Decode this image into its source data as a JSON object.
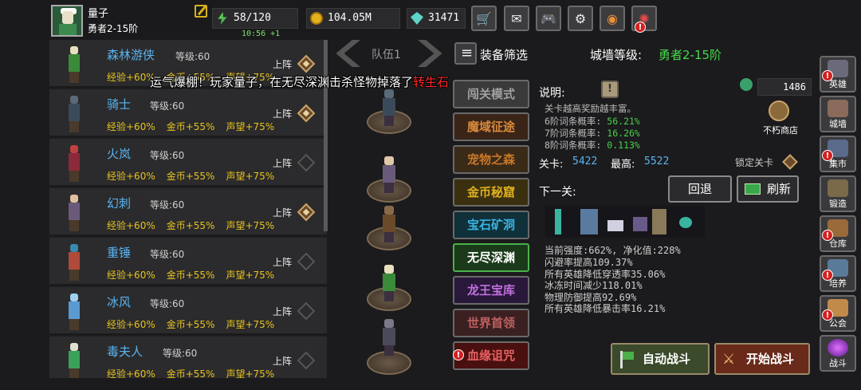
{
  "player": {
    "name": "量子",
    "rank": "勇者2-15阶",
    "energy": "58/120",
    "energy_timer": "10:56 +1",
    "gold": "104.05M",
    "gems": "31471"
  },
  "top_buttons": [
    {
      "name": "shop-cart-button",
      "glyph": "🛒"
    },
    {
      "name": "mail-button",
      "glyph": "✉"
    },
    {
      "name": "gamepad-button",
      "glyph": "🎮"
    },
    {
      "name": "settings-button",
      "glyph": "⚙"
    },
    {
      "name": "color-wheel-button",
      "glyph": "◉"
    },
    {
      "name": "fireworks-button",
      "glyph": "✺"
    }
  ],
  "alert_mark": "!",
  "notice": {
    "text": "运气爆棚！玩家量子，在无尽深渊击杀怪物掉落了",
    "item": "转生石"
  },
  "hero_list": {
    "level_label": "等级:",
    "deploy_label": "上阵",
    "heroes": [
      {
        "name": "森林游侠",
        "level": "60",
        "exp": "经验+60%",
        "gold": "金币+55%",
        "fame": "声望+75%",
        "deployed": true
      },
      {
        "name": "骑士",
        "level": "60",
        "exp": "经验+60%",
        "gold": "金币+55%",
        "fame": "声望+75%",
        "deployed": true
      },
      {
        "name": "火岚",
        "level": "60",
        "exp": "经验+60%",
        "gold": "金币+55%",
        "fame": "声望+75%",
        "deployed": false
      },
      {
        "name": "幻刺",
        "level": "60",
        "exp": "经验+60%",
        "gold": "金币+55%",
        "fame": "声望+75%",
        "deployed": true
      },
      {
        "name": "重锤",
        "level": "60",
        "exp": "经验+60%",
        "gold": "金币+55%",
        "fame": "声望+75%",
        "deployed": false
      },
      {
        "name": "冰风",
        "level": "60",
        "exp": "经验+60%",
        "gold": "金币+55%",
        "fame": "声望+75%",
        "deployed": false
      },
      {
        "name": "毒夫人",
        "level": "60",
        "exp": "经验+60%",
        "gold": "金币+55%",
        "fame": "声望+75%",
        "deployed": false
      }
    ]
  },
  "team": {
    "label": "队伍1"
  },
  "filter": {
    "label": "装备筛选"
  },
  "wall": {
    "label": "城墙等级:",
    "value": "勇者2-15阶"
  },
  "modes": [
    {
      "label": "闯关模式",
      "bg": "#3a3a3a",
      "color": "#a0a0a0"
    },
    {
      "label": "魔域征途",
      "bg": "#3a2418",
      "color": "#d88a3a"
    },
    {
      "label": "宠物之森",
      "bg": "#3a2a18",
      "color": "#c8782a"
    },
    {
      "label": "金币秘窟",
      "bg": "#3a3010",
      "color": "#e0b020"
    },
    {
      "label": "宝石矿洞",
      "bg": "#10303a",
      "color": "#3ab4e0"
    },
    {
      "label": "无尽深渊",
      "bg": "#1a3a1a",
      "color": "#ffffff"
    },
    {
      "label": "龙王宝库",
      "bg": "#2a183a",
      "color": "#c070e0"
    },
    {
      "label": "世界首领",
      "bg": "#3a2020",
      "color": "#c06060"
    },
    {
      "label": "血缘诅咒",
      "bg": "#4a1010",
      "color": "#e86060"
    }
  ],
  "detail": {
    "desc_label": "说明:",
    "question_mark": "!",
    "bug_count": "1486",
    "shop_label": "不朽商店",
    "info_title": "关卡越高奖励越丰富。",
    "chances": [
      {
        "label": "6阶词条概率:",
        "value": "56.21%"
      },
      {
        "label": "7阶词条概率:",
        "value": "16.26%"
      },
      {
        "label": "8阶词条概率:",
        "value": "0.113%"
      }
    ],
    "stage_label": "关卡:",
    "stage_value": "5422",
    "max_label": "最高:",
    "max_value": "5522",
    "lock_label": "锁定关卡",
    "next_label": "下一关:",
    "back_button": "回退",
    "refresh_button": "刷新",
    "stats": [
      "当前强度:662%, 净化值:228%",
      "闪避率提高109.37%",
      "所有英雄降低穿透率35.06%",
      "冰冻时间减少118.01%",
      "物理防御提高92.69%",
      "所有英雄降低暴击率16.21%"
    ],
    "auto_battle": "自动战斗",
    "start_battle": "开始战斗"
  },
  "sidebar": [
    {
      "label": "英雄",
      "alert": true
    },
    {
      "label": "城墙",
      "alert": false
    },
    {
      "label": "集市",
      "alert": true
    },
    {
      "label": "锻造",
      "alert": false
    },
    {
      "label": "仓库",
      "alert": true
    },
    {
      "label": "培养",
      "alert": true
    },
    {
      "label": "公会",
      "alert": true
    },
    {
      "label": "战斗",
      "alert": false
    }
  ],
  "colors": {
    "accent_green": "#48d84a",
    "gold_text": "#e7c21e",
    "hero_name_blue": "#5ab4f0",
    "alert_red": "#d42020"
  }
}
